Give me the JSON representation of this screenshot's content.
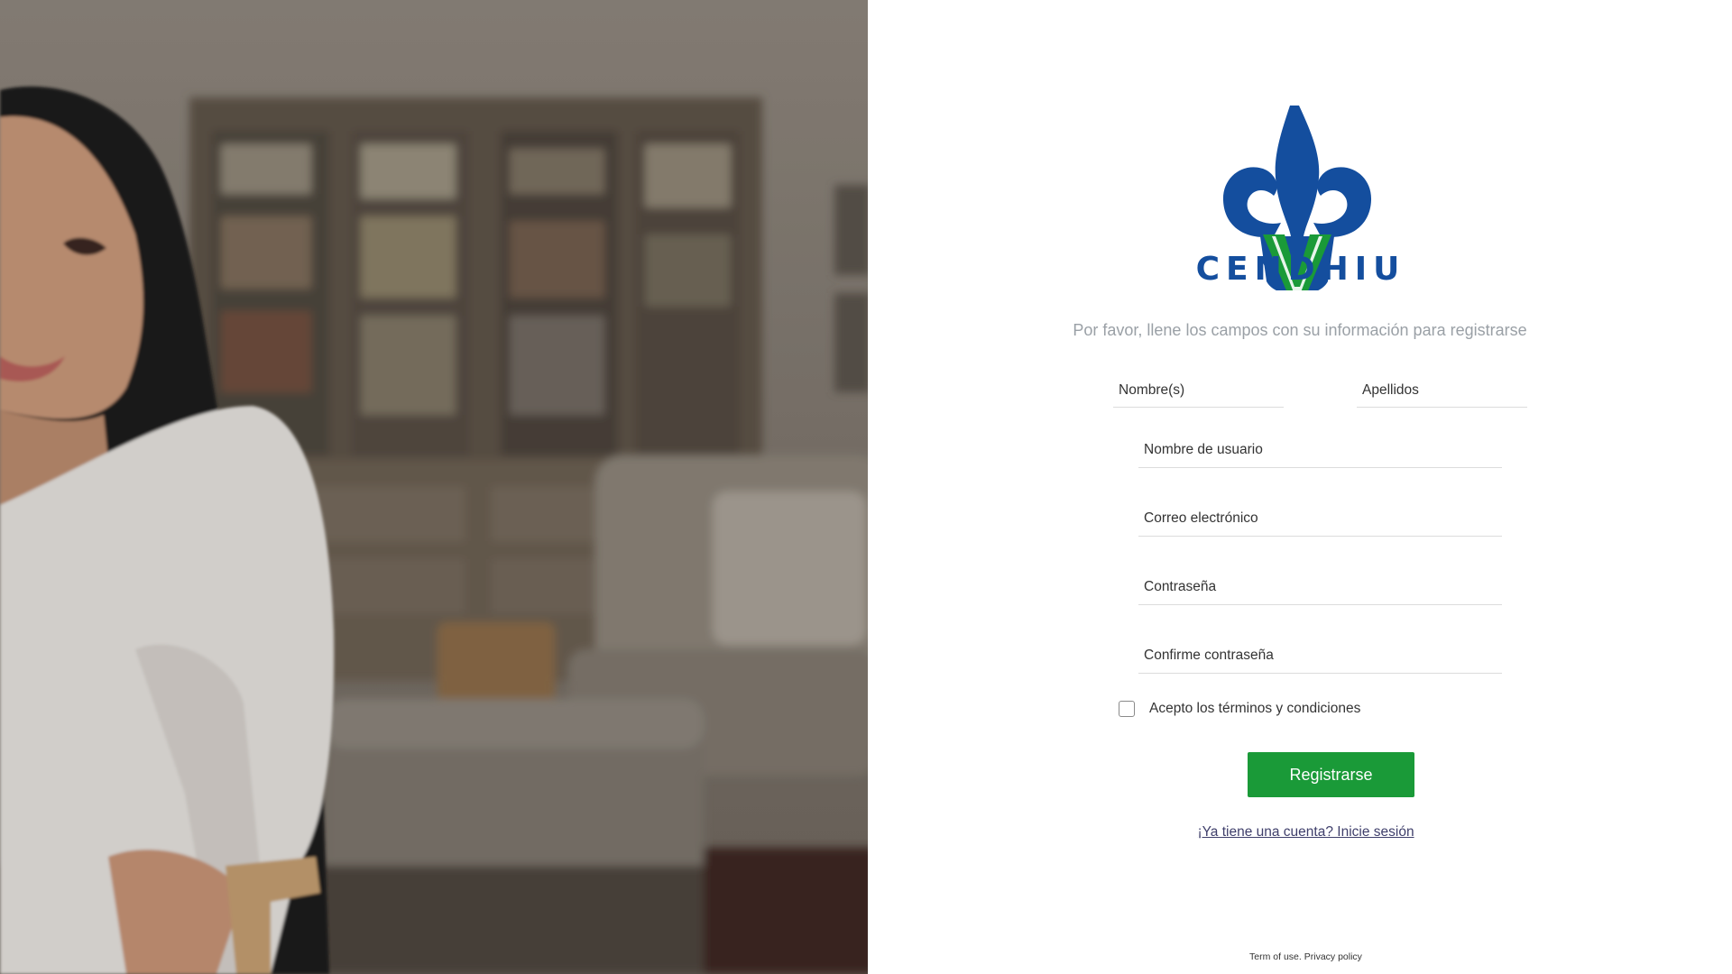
{
  "brand": {
    "name": "CENDHIU",
    "colors": {
      "blue": "#144e9e",
      "green": "#1a9a38"
    }
  },
  "form": {
    "subtitle": "Por favor, llene los campos con su información para registrarse",
    "first_name_placeholder": "Nombre(s)",
    "last_name_placeholder": "Apellidos",
    "username_placeholder": "Nombre de usuario",
    "email_placeholder": "Correo electrónico",
    "password_placeholder": "Contraseña",
    "confirm_password_placeholder": "Confirme contraseña",
    "terms_label": "Acepto los términos y condiciones",
    "terms_checked": false,
    "submit_label": "Registrarse",
    "login_link": "¡Ya tiene una cuenta? Inicie sesión"
  },
  "footer": {
    "terms_link": "Term of use.",
    "privacy_link": "Privacy policy"
  }
}
